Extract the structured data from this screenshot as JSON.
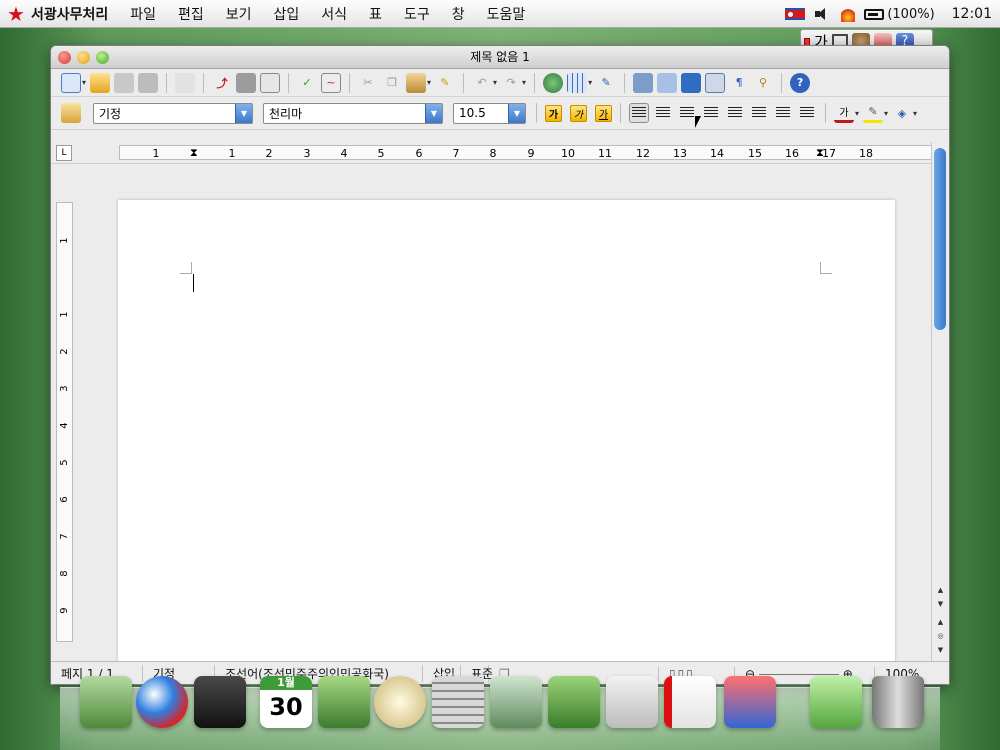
{
  "menubar": {
    "app_name": "서광사무처리",
    "items": [
      "파일",
      "편집",
      "보기",
      "삽입",
      "서식",
      "표",
      "도구",
      "창",
      "도움말"
    ],
    "battery": "(100%)",
    "clock": "12:01"
  },
  "ime": {
    "label": "가"
  },
  "window": {
    "title": "제목 없음 1",
    "formatting": {
      "paragraph_style": "기정",
      "font_name": "천리마",
      "font_size": "10.5",
      "bold_label": "가",
      "italic_label": "가",
      "underline_label": "가",
      "font_color_label": "가"
    },
    "ruler": {
      "corner": "L",
      "numbers": [
        "1",
        "1",
        "2",
        "3",
        "4",
        "5",
        "6",
        "7",
        "8",
        "9",
        "10",
        "11",
        "12",
        "13",
        "14",
        "15",
        "16",
        "17",
        "18"
      ],
      "vertical_numbers": [
        "1",
        "1",
        "2",
        "3",
        "4",
        "5",
        "6",
        "7",
        "8",
        "9"
      ]
    },
    "status": {
      "page": "페지  1 / 1",
      "style": "기정",
      "language": "조선어(조선민주주의인민공화국)",
      "mode": "삽입",
      "selection": "표준",
      "zoom": "100%"
    }
  },
  "dock": {
    "calendar_month": "1월",
    "calendar_day": "30"
  },
  "colors": {
    "accent": "#3a78cc",
    "star": "#d7121e"
  }
}
